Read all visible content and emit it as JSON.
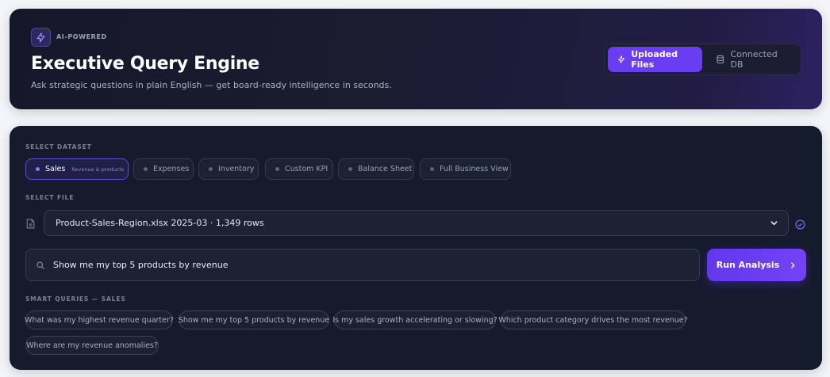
{
  "header": {
    "badge": "AI-POWERED",
    "title": "Executive Query Engine",
    "subtitle": "Ask strategic questions in plain English — get board-ready intelligence in seconds.",
    "sources": [
      {
        "label": "Uploaded Files",
        "icon": "bolt-icon",
        "active": true
      },
      {
        "label": "Connected DB",
        "icon": "database-icon",
        "active": false
      }
    ]
  },
  "dataset": {
    "label": "SELECT DATASET",
    "options": [
      {
        "label": "Sales",
        "sub": "Revenue & products",
        "active": true
      },
      {
        "label": "Expenses"
      },
      {
        "label": "Inventory"
      },
      {
        "label": "Custom KPI"
      },
      {
        "label": "Balance Sheet"
      },
      {
        "label": "Full Business View"
      }
    ]
  },
  "file": {
    "label": "SELECT FILE",
    "selected": "Product-Sales-Region.xlsx 2025-03 · 1,349 rows"
  },
  "query": {
    "value": "Show me my top 5 products by revenue",
    "run_label": "Run Analysis"
  },
  "smart_queries": {
    "label": "SMART QUERIES — SALES",
    "items": [
      "What was my highest revenue quarter?",
      "Show me my top 5 products by revenue",
      "Is my sales growth accelerating or slowing?",
      "Which product category drives the most revenue?",
      "Where are my revenue anomalies?"
    ]
  },
  "colors": {
    "accent": "#6a3df0",
    "card_bg": "#151a2c",
    "chip_bg": "#1b2133"
  }
}
